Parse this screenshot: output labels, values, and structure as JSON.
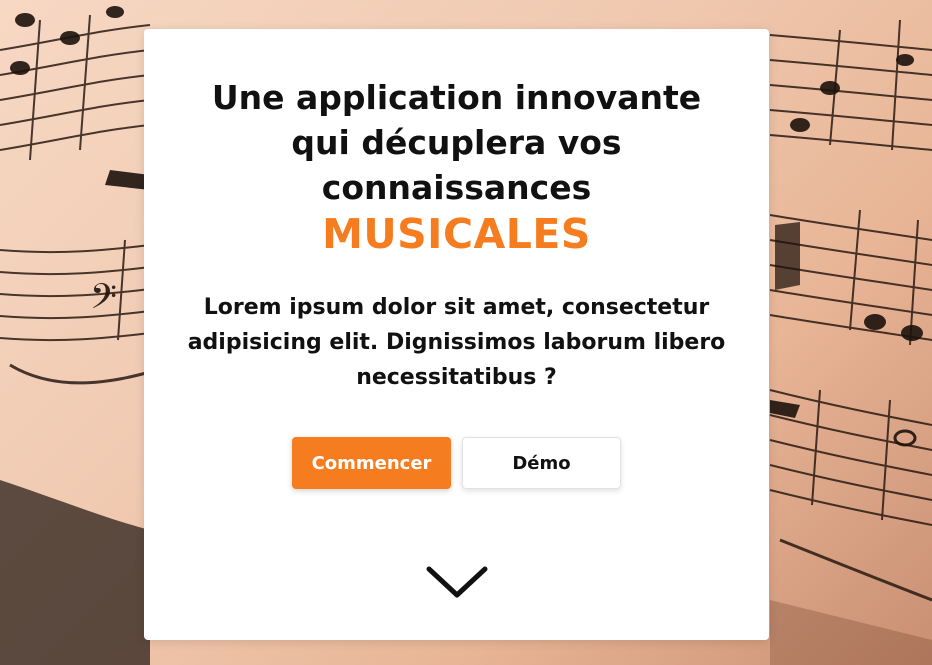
{
  "hero": {
    "title": "Une application innovante qui décuplera vos connaissances",
    "highlight": "MUSICALES",
    "description": "Lorem ipsum dolor sit amet, consectetur adipisicing elit. Dignissimos laborum libero necessitatibus ?",
    "start_button": "Commencer",
    "demo_button": "Démo",
    "scroll_icon": "chevron-down-icon"
  },
  "colors": {
    "accent": "#f57c1f",
    "background_tint": "#f7d8c4",
    "text": "#111111"
  }
}
